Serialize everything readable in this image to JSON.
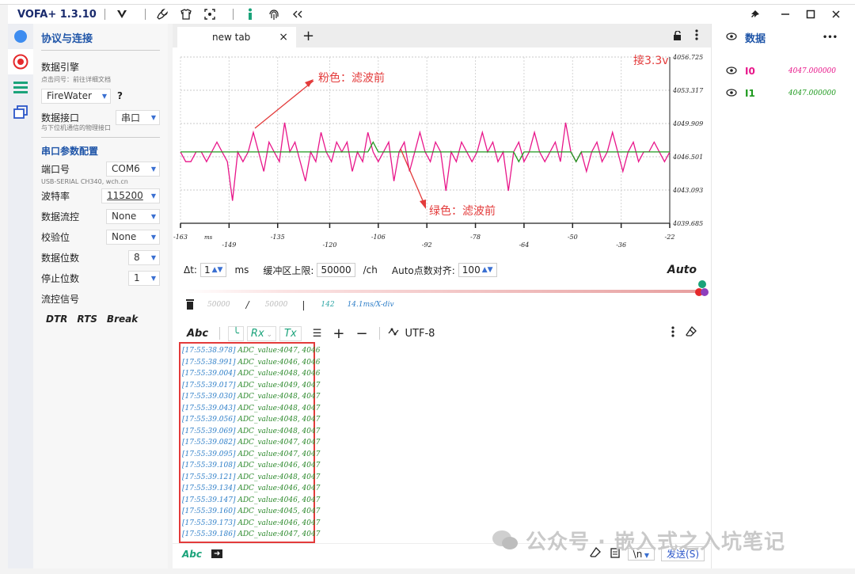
{
  "app": {
    "title": "VOFA+ 1.3.10"
  },
  "sidebar": {
    "header": "协议与连接",
    "engine_label": "数据引擎",
    "engine_hint": "点击问号：前往详细文档",
    "engine_value": "FireWater",
    "help": "?",
    "port_label": "数据接口",
    "port_hint": "与下位机通信的物理接口",
    "port_value": "串口",
    "serial_header": "串口参数配置",
    "com_label": "端口号",
    "com_value": "COM6",
    "com_hint": "USB-SERIAL CH340, wch.cn",
    "baud_label": "波特率",
    "baud_value": "115200",
    "flow_label": "数据流控",
    "flow_value": "None",
    "parity_label": "校验位",
    "parity_value": "None",
    "databits_label": "数据位数",
    "databits_value": "8",
    "stopbits_label": "停止位数",
    "stopbits_value": "1",
    "signal_label": "流控信号",
    "signals": [
      "DTR",
      "RTS",
      "Break"
    ]
  },
  "tabs": {
    "active": "new tab",
    "close": "×",
    "add": "+"
  },
  "chart_data": {
    "type": "line",
    "y_ticks": [
      "4056.725",
      "4053.317",
      "4049.909",
      "4046.501",
      "4043.093",
      "4039.685"
    ],
    "x_ticks": [
      "-163",
      "-149",
      "-135",
      "-120",
      "-106",
      "-92",
      "-78",
      "-64",
      "-50",
      "-36",
      "-22"
    ],
    "x_unit": "ms",
    "ylim": [
      4039.685,
      4056.725
    ],
    "xlim": [
      -163,
      -22
    ],
    "series": [
      {
        "name": "I0",
        "color": "#e8168a",
        "values": [
          4047,
          4046,
          4046,
          4047,
          4047,
          4046,
          4047,
          4048,
          4047,
          4046,
          4042,
          4047,
          4046,
          4047,
          4049,
          4047,
          4045,
          4048,
          4047,
          4046,
          4050,
          4047,
          4048,
          4046,
          4044,
          4047,
          4046,
          4049,
          4047,
          4046,
          4048,
          4047,
          4048,
          4045,
          4047,
          4046,
          4049,
          4047,
          4046,
          4047,
          4048,
          4044,
          4047,
          4048,
          4045,
          4047,
          4049,
          4047,
          4046,
          4048,
          4047,
          4043,
          4047,
          4046,
          4048,
          4047,
          4046,
          4047,
          4049,
          4047,
          4048,
          4046,
          4047,
          4043,
          4047,
          4048,
          4046,
          4047,
          4049,
          4047,
          4046,
          4047,
          4048,
          4046,
          4050,
          4047,
          4046,
          4047,
          4045,
          4047,
          4048,
          4046,
          4047,
          4049,
          4047,
          4045,
          4047,
          4048,
          4046,
          4047,
          4047,
          4048,
          4047,
          4046,
          4047
        ]
      },
      {
        "name": "I1",
        "color": "#1f9a1f",
        "values": [
          4047,
          4047,
          4047,
          4047,
          4047,
          4047,
          4047,
          4047,
          4047,
          4047,
          4047,
          4047,
          4047,
          4047,
          4047,
          4047,
          4047,
          4047,
          4047,
          4047,
          4047,
          4047,
          4047,
          4047,
          4047,
          4047,
          4047,
          4047,
          4047,
          4047,
          4047,
          4047,
          4047,
          4047,
          4047,
          4047,
          4047,
          4048,
          4047,
          4047,
          4047,
          4047,
          4047,
          4047,
          4047,
          4047,
          4047,
          4047,
          4047,
          4047,
          4047,
          4047,
          4047,
          4047,
          4047,
          4047,
          4047,
          4047,
          4047,
          4047,
          4047,
          4047,
          4047,
          4047,
          4047,
          4046,
          4047,
          4047,
          4047,
          4047,
          4047,
          4047,
          4047,
          4047,
          4047,
          4047,
          4046,
          4047,
          4047,
          4047,
          4047,
          4047,
          4047,
          4047,
          4047,
          4047,
          4047,
          4047,
          4047,
          4047,
          4047,
          4047,
          4047,
          4047,
          4047
        ]
      }
    ],
    "annotations": [
      "接3.3v",
      "粉色：滤波前",
      "绿色：滤波前"
    ],
    "grid": true
  },
  "controls": {
    "dt_label": "Δt:",
    "dt_value": "1",
    "dt_unit": "ms",
    "buffer_label": "缓冲区上限:",
    "buffer_value": "50000",
    "buffer_unit": "/ch",
    "auto_align_label": "Auto点数对齐:",
    "auto_align_value": "100",
    "auto_label": "Auto"
  },
  "status": {
    "left": "50000",
    "slash": "/",
    "right": "50000",
    "bar": "|",
    "count": "142",
    "scale": "14.1ms/X-div"
  },
  "toolbar": {
    "abc": "Abc",
    "rx": "Rx",
    "tx": "Tx",
    "plus": "+",
    "minus": "−",
    "encoding": "UTF-8"
  },
  "log": [
    {
      "ts": "[17:55:38.978]",
      "text": "ADC_value:4047, 4046"
    },
    {
      "ts": "[17:55:38.991]",
      "text": "ADC_value:4046, 4046"
    },
    {
      "ts": "[17:55:39.004]",
      "text": "ADC_value:4048, 4046"
    },
    {
      "ts": "[17:55:39.017]",
      "text": "ADC_value:4049, 4047"
    },
    {
      "ts": "[17:55:39.030]",
      "text": "ADC_value:4048, 4047"
    },
    {
      "ts": "[17:55:39.043]",
      "text": "ADC_value:4048, 4047"
    },
    {
      "ts": "[17:55:39.056]",
      "text": "ADC_value:4048, 4047"
    },
    {
      "ts": "[17:55:39.069]",
      "text": "ADC_value:4048, 4047"
    },
    {
      "ts": "[17:55:39.082]",
      "text": "ADC_value:4047, 4047"
    },
    {
      "ts": "[17:55:39.095]",
      "text": "ADC_value:4047, 4047"
    },
    {
      "ts": "[17:55:39.108]",
      "text": "ADC_value:4046, 4047"
    },
    {
      "ts": "[17:55:39.121]",
      "text": "ADC_value:4048, 4047"
    },
    {
      "ts": "[17:55:39.134]",
      "text": "ADC_value:4046, 4047"
    },
    {
      "ts": "[17:55:39.147]",
      "text": "ADC_value:4046, 4047"
    },
    {
      "ts": "[17:55:39.160]",
      "text": "ADC_value:4045, 4047"
    },
    {
      "ts": "[17:55:39.173]",
      "text": "ADC_value:4046, 4047"
    },
    {
      "ts": "[17:55:39.186]",
      "text": "ADC_value:4047, 4047"
    }
  ],
  "bottom": {
    "abc": "Abc",
    "newline": "\\n",
    "send": "发送(S)"
  },
  "data_panel": {
    "title": "数据",
    "more": "•••",
    "channels": [
      {
        "name": "I0",
        "value": "4047.000000",
        "color": "#e8168a"
      },
      {
        "name": "I1",
        "value": "4047.000000",
        "color": "#1f9a1f"
      }
    ]
  },
  "watermark": "公众号 · 嵌入式之入坑笔记",
  "colors": {
    "accent": "#1f55a8",
    "pink": "#e8168a",
    "green": "#1f9a1f",
    "annotation": "#e33b3b"
  }
}
